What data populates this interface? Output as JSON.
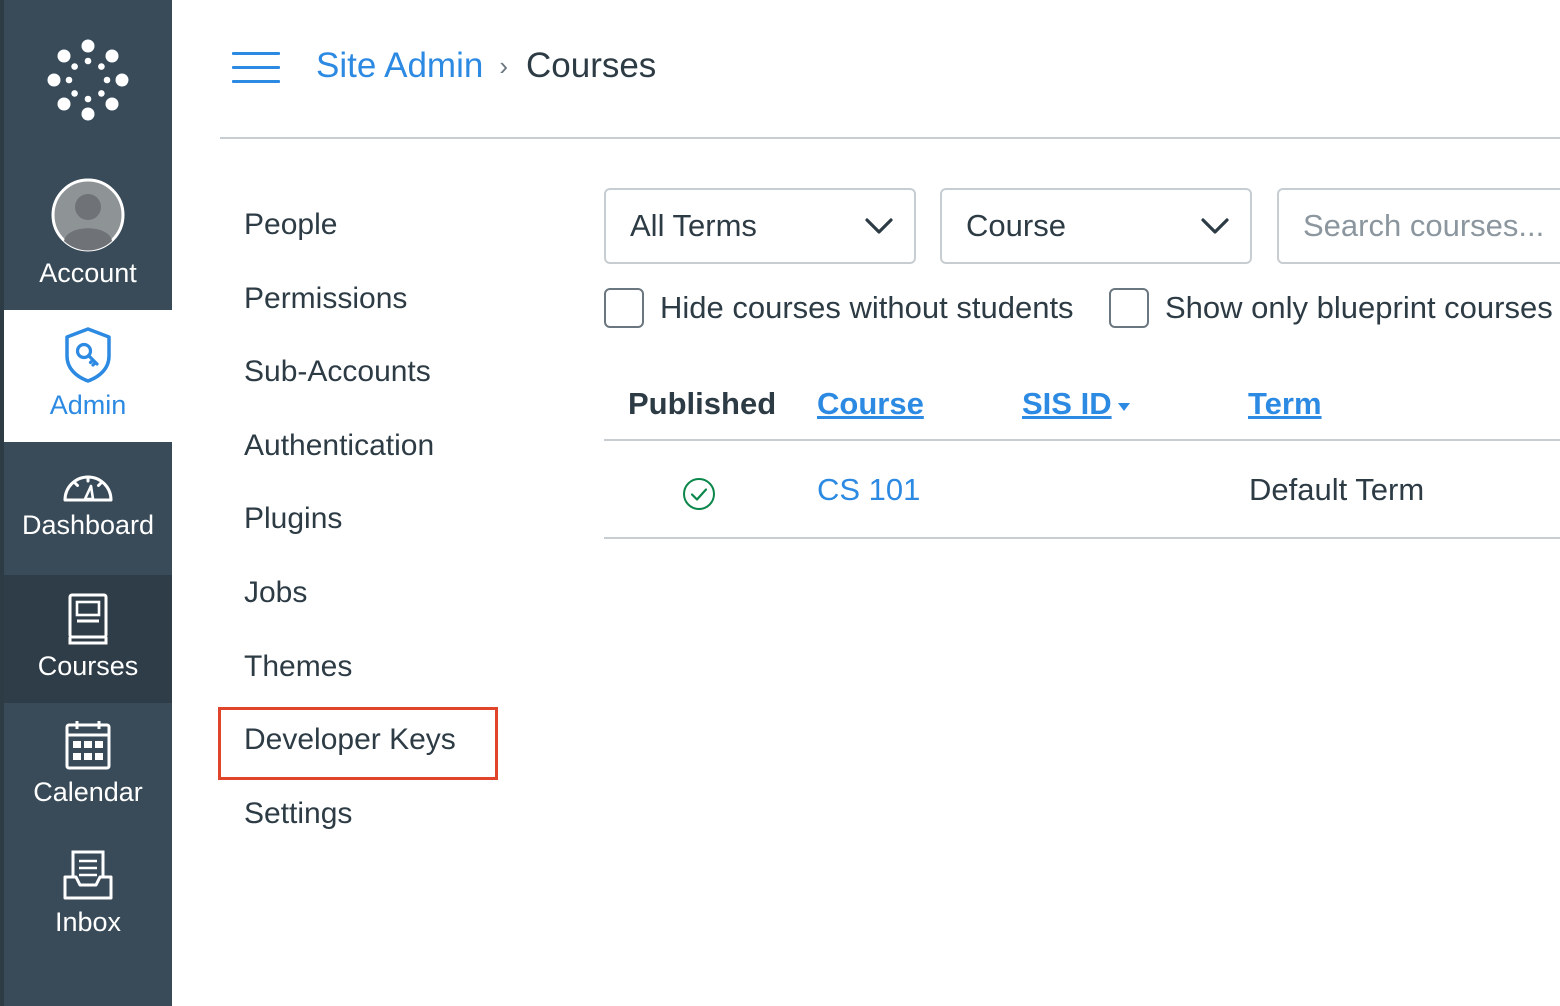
{
  "global_nav": {
    "account": "Account",
    "admin": "Admin",
    "dashboard": "Dashboard",
    "courses": "Courses",
    "calendar": "Calendar",
    "inbox": "Inbox"
  },
  "header": {
    "breadcrumb_parent": "Site Admin",
    "breadcrumb_separator": "›",
    "breadcrumb_current": "Courses"
  },
  "section_menu": {
    "items": [
      {
        "label": "People"
      },
      {
        "label": "Permissions"
      },
      {
        "label": "Sub-Accounts"
      },
      {
        "label": "Authentication"
      },
      {
        "label": "Plugins"
      },
      {
        "label": "Jobs"
      },
      {
        "label": "Themes"
      },
      {
        "label": "Developer Keys"
      },
      {
        "label": "Settings"
      }
    ]
  },
  "filters": {
    "term_select": "All Terms",
    "type_select": "Course",
    "search_placeholder": "Search courses...",
    "hide_without_students": "Hide courses without students",
    "blueprint_only": "Show only blueprint courses"
  },
  "table": {
    "columns": {
      "published": "Published",
      "course": "Course",
      "sis_id": "SIS ID",
      "term": "Term"
    },
    "rows": [
      {
        "course": "CS 101",
        "sis_id": "",
        "term": "Default Term"
      }
    ]
  },
  "colors": {
    "nav_bg": "#394b58",
    "accent": "#2d8ae3",
    "highlight": "#e0452b",
    "published": "#0b874b"
  }
}
